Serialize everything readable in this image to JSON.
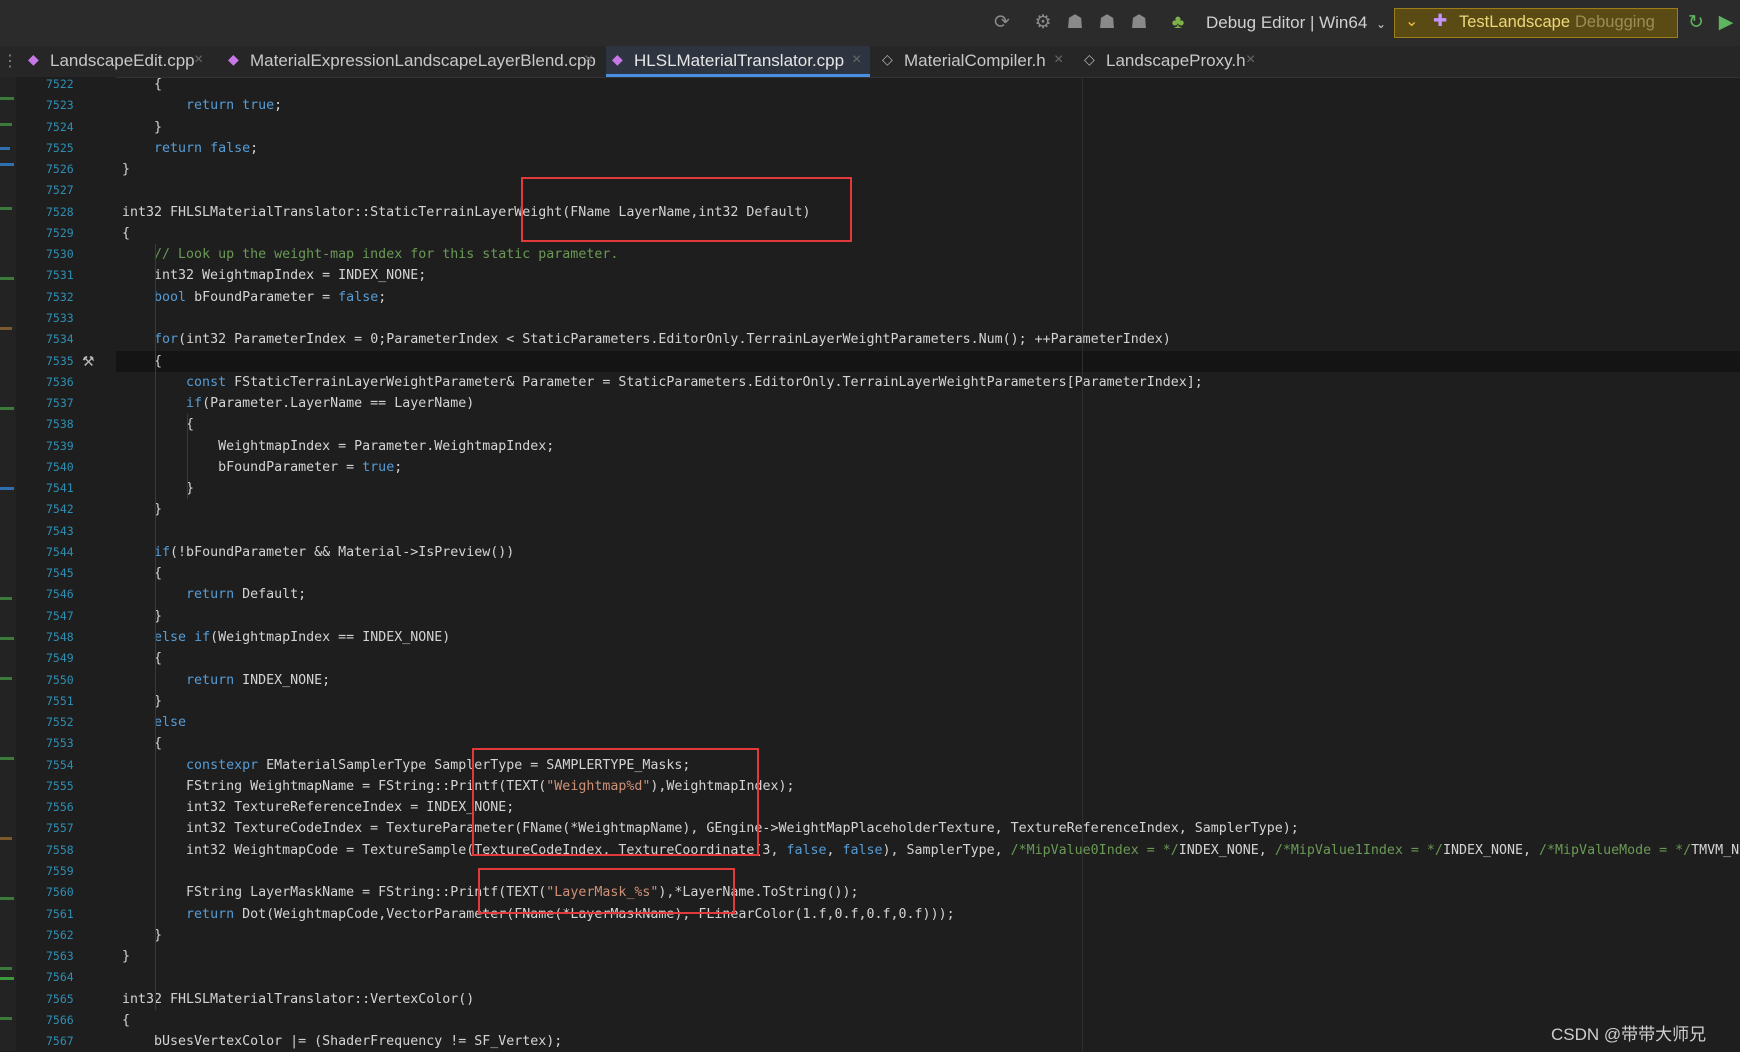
{
  "toolbar": {
    "config_label": "Debug Editor | Win64",
    "run_project": "TestLandscape",
    "run_state": "Debugging"
  },
  "tabs": [
    {
      "label": "LandscapeEdit.cpp"
    },
    {
      "label": "MaterialExpressionLandscapeLayerBlend.cpp"
    },
    {
      "label": "HLSLMaterialTranslator.cpp"
    },
    {
      "label": "MaterialCompiler.h"
    },
    {
      "label": "LandscapeProxy.h"
    }
  ],
  "code": [
    {
      "n": "7522",
      "t": "    {"
    },
    {
      "n": "7523",
      "t": "        <span class=\"kw\">return</span> <span class=\"kw\">true</span>;"
    },
    {
      "n": "7524",
      "t": "    }"
    },
    {
      "n": "7525",
      "t": "    <span class=\"kw\">return</span> <span class=\"kw\">false</span>;"
    },
    {
      "n": "7526",
      "t": "}"
    },
    {
      "n": "7527",
      "t": ""
    },
    {
      "n": "7528",
      "t": "int32 FHLSLMaterialTranslator::StaticTerrainLayerWeight(FName LayerName,int32 Default)"
    },
    {
      "n": "7529",
      "t": "{"
    },
    {
      "n": "7530",
      "t": "    <span class=\"cm\">// Look up the weight-map index for this static parameter.</span>"
    },
    {
      "n": "7531",
      "t": "    int32 WeightmapIndex = INDEX_NONE;"
    },
    {
      "n": "7532",
      "t": "    <span class=\"kw\">bool</span> bFoundParameter = <span class=\"kw\">false</span>;"
    },
    {
      "n": "7533",
      "t": ""
    },
    {
      "n": "7534",
      "t": "    <span class=\"kw\">for</span>(int32 ParameterIndex = 0;ParameterIndex &lt; StaticParameters.EditorOnly.TerrainLayerWeightParameters.Num(); ++ParameterIndex)"
    },
    {
      "n": "7535",
      "t": "    {"
    },
    {
      "n": "7536",
      "t": "        <span class=\"kw\">const</span> FStaticTerrainLayerWeightParameter&amp; Parameter = StaticParameters.EditorOnly.TerrainLayerWeightParameters[ParameterIndex];"
    },
    {
      "n": "7537",
      "t": "        <span class=\"kw\">if</span>(Parameter.LayerName == LayerName)"
    },
    {
      "n": "7538",
      "t": "        {"
    },
    {
      "n": "7539",
      "t": "            WeightmapIndex = Parameter.WeightmapIndex;"
    },
    {
      "n": "7540",
      "t": "            bFoundParameter = <span class=\"kw\">true</span>;"
    },
    {
      "n": "7541",
      "t": "        }"
    },
    {
      "n": "7542",
      "t": "    }"
    },
    {
      "n": "7543",
      "t": ""
    },
    {
      "n": "7544",
      "t": "    <span class=\"kw\">if</span>(!bFoundParameter &amp;&amp; Material-&gt;IsPreview())"
    },
    {
      "n": "7545",
      "t": "    {"
    },
    {
      "n": "7546",
      "t": "        <span class=\"kw\">return</span> Default;"
    },
    {
      "n": "7547",
      "t": "    }"
    },
    {
      "n": "7548",
      "t": "    <span class=\"kw\">else</span> <span class=\"kw\">if</span>(WeightmapIndex == INDEX_NONE)"
    },
    {
      "n": "7549",
      "t": "    {"
    },
    {
      "n": "7550",
      "t": "        <span class=\"kw\">return</span> INDEX_NONE;"
    },
    {
      "n": "7551",
      "t": "    }"
    },
    {
      "n": "7552",
      "t": "    <span class=\"kw\">else</span>"
    },
    {
      "n": "7553",
      "t": "    {"
    },
    {
      "n": "7554",
      "t": "        <span class=\"kw\">constexpr</span> EMaterialSamplerType SamplerType = SAMPLERTYPE_Masks;"
    },
    {
      "n": "7555",
      "t": "        FString WeightmapName = FString::Printf(TEXT(<span class=\"str\">\"Weightmap%d\"</span>),WeightmapIndex);"
    },
    {
      "n": "7556",
      "t": "        int32 TextureReferenceIndex = INDEX_NONE;"
    },
    {
      "n": "7557",
      "t": "        int32 TextureCodeIndex = TextureParameter(FName(*WeightmapName), GEngine-&gt;WeightMapPlaceholderTexture, TextureReferenceIndex, SamplerType);"
    },
    {
      "n": "7558",
      "t": "        int32 WeightmapCode = TextureSample(TextureCodeIndex, TextureCoordinate(3, <span class=\"kw\">false</span>, <span class=\"kw\">false</span>), SamplerType, <span class=\"cm\">/*MipValue0Index = */</span>INDEX_NONE, <span class=\"cm\">/*MipValue1Index = */</span>INDEX_NONE, <span class=\"cm\">/*MipValueMode = */</span>TMVM_None"
    },
    {
      "n": "7559",
      "t": ""
    },
    {
      "n": "7560",
      "t": "        FString LayerMaskName = FString::Printf(TEXT(<span class=\"str\">\"LayerMask_%s\"</span>),*LayerName.ToString());"
    },
    {
      "n": "7561",
      "t": "        <span class=\"kw\">return</span> Dot(WeightmapCode,VectorParameter(FName(*LayerMaskName), FLinearColor(1.f,0.f,0.f,0.f)));"
    },
    {
      "n": "7562",
      "t": "    }"
    },
    {
      "n": "7563",
      "t": "}"
    },
    {
      "n": "7564",
      "t": ""
    },
    {
      "n": "7565",
      "t": "int32 FHLSLMaterialTranslator::VertexColor()"
    },
    {
      "n": "7566",
      "t": "{"
    },
    {
      "n": "7567",
      "t": "    bUsesVertexColor |= (ShaderFrequency != SF_Vertex);"
    }
  ],
  "watermark": "CSDN @带带大师兄"
}
